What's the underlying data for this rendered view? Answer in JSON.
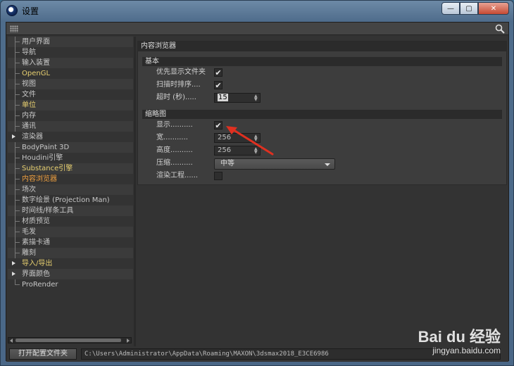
{
  "window": {
    "title": "设置",
    "min_label": "—",
    "max_label": "▢",
    "close_label": "✕"
  },
  "sidebar": {
    "items": [
      {
        "label": "用户界面",
        "state": "normal"
      },
      {
        "label": "导航",
        "state": "normal"
      },
      {
        "label": "输入装置",
        "state": "normal"
      },
      {
        "label": "OpenGL",
        "state": "highlight"
      },
      {
        "label": "视图",
        "state": "normal"
      },
      {
        "label": "文件",
        "state": "normal"
      },
      {
        "label": "单位",
        "state": "highlight"
      },
      {
        "label": "内存",
        "state": "normal"
      },
      {
        "label": "通讯",
        "state": "normal"
      },
      {
        "label": "渲染器",
        "state": "expandable"
      },
      {
        "label": "BodyPaint 3D",
        "state": "normal"
      },
      {
        "label": "Houdini引擎",
        "state": "normal"
      },
      {
        "label": "Substance引擎",
        "state": "highlight"
      },
      {
        "label": "内容浏览器",
        "state": "active"
      },
      {
        "label": "场次",
        "state": "normal"
      },
      {
        "label": "数字绘景 (Projection Man)",
        "state": "normal"
      },
      {
        "label": "时间线/样条工具",
        "state": "normal"
      },
      {
        "label": "材质预览",
        "state": "normal"
      },
      {
        "label": "毛发",
        "state": "normal"
      },
      {
        "label": "素描卡通",
        "state": "normal"
      },
      {
        "label": "雕刻",
        "state": "normal"
      },
      {
        "label": "导入/导出",
        "state": "expandable-highlight"
      },
      {
        "label": "界面颜色",
        "state": "expandable"
      },
      {
        "label": "ProRender",
        "state": "last"
      }
    ]
  },
  "panel": {
    "title": "内容浏览器",
    "basic": {
      "header": "基本",
      "prefer_folders_label": "优先显示文件夹",
      "prefer_folders_checked": true,
      "sort_on_scan_label": "扫描时排序....",
      "sort_on_scan_checked": true,
      "timeout_label": "超时 (秒).....",
      "timeout_value": "15"
    },
    "thumbnails": {
      "header": "缩略图",
      "show_label": "显示..........",
      "show_checked": true,
      "width_label": "宽...........",
      "width_value": "256",
      "height_label": "高度..........",
      "height_value": "256",
      "compress_label": "压缩..........",
      "compress_value": "中等",
      "render_project_label": "渲染工程......",
      "render_project_checked": false
    }
  },
  "footer": {
    "open_folder_label": "打开配置文件夹",
    "path": "C:\\Users\\Administrator\\AppData\\Roaming\\MAXON\\3dsmax2018_E3CE6986"
  },
  "watermark": {
    "line1": "Bai du 经验",
    "line2": "jingyan.baidu.com"
  },
  "colors": {
    "highlight": "#e8d070",
    "active": "#f0a040",
    "annotation_arrow": "#e03020"
  }
}
